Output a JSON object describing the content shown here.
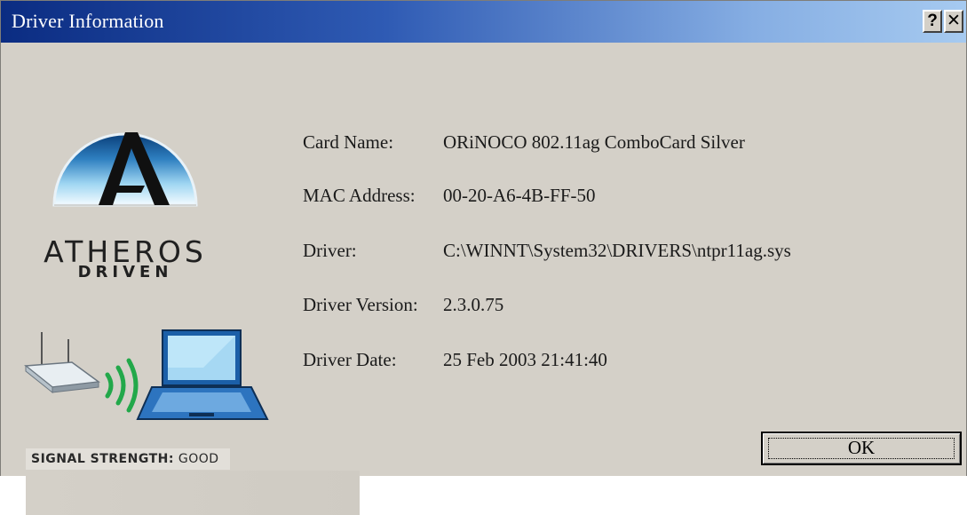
{
  "window": {
    "title": "Driver Information",
    "help_label": "?",
    "close_label": "✕"
  },
  "brand": {
    "line1": "ATHEROS",
    "line2": "DRIVEN"
  },
  "signal": {
    "label": "SIGNAL STRENGTH:",
    "value": "GOOD"
  },
  "info": {
    "card_name": {
      "label": "Card Name:",
      "value": "ORiNOCO 802.11ag ComboCard Silver"
    },
    "mac_address": {
      "label": "MAC Address:",
      "value": "00-20-A6-4B-FF-50"
    },
    "driver": {
      "label": "Driver:",
      "value": "C:\\WINNT\\System32\\DRIVERS\\ntpr11ag.sys"
    },
    "driver_version": {
      "label": "Driver Version:",
      "value": "2.3.0.75"
    },
    "driver_date": {
      "label": "Driver Date:",
      "value": "25 Feb 2003 21:41:40"
    }
  },
  "buttons": {
    "ok_label": "OK"
  },
  "colors": {
    "title_gradient_start": "#0b2c82",
    "title_gradient_end": "#a6caf0",
    "dialog_bg": "#d4d0c8",
    "signal_arc": "#22a84a"
  },
  "icons": [
    "atheros-logo",
    "router-icon",
    "signal-waves-icon",
    "laptop-icon",
    "help-icon",
    "close-icon"
  ]
}
